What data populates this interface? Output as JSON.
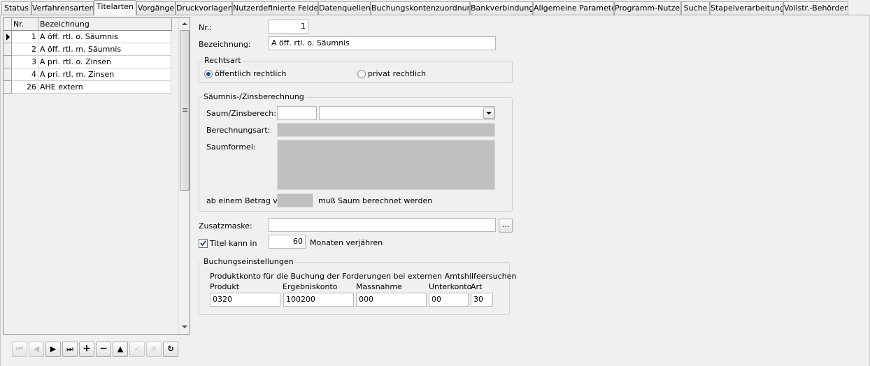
{
  "tabs": [
    {
      "label": "Status"
    },
    {
      "label": "Verfahrensarten"
    },
    {
      "label": "Titelarten"
    },
    {
      "label": "Vorgänge"
    },
    {
      "label": "Druckvorlagen"
    },
    {
      "label": "Nutzerdefinierte Felder"
    },
    {
      "label": "Datenquellen"
    },
    {
      "label": "Buchungskontenzuordnung"
    },
    {
      "label": "Bankverbindung"
    },
    {
      "label": "Allgemeine Parameter"
    },
    {
      "label": "Programm-Nutzer"
    },
    {
      "label": "Suche"
    },
    {
      "label": "Stapelverarbeitung"
    },
    {
      "label": "Vollstr.-Behörden"
    }
  ],
  "active_tab": "Titelarten",
  "grid": {
    "columns": {
      "nr": "Nr.",
      "bez": "Bezeichnung"
    },
    "rows": [
      {
        "nr": "1",
        "bez": "A öff. rtl. o. Säumnis"
      },
      {
        "nr": "2",
        "bez": "A öff. rtl. m. Säumnis"
      },
      {
        "nr": "3",
        "bez": "A pri. rtl. o. Zinsen"
      },
      {
        "nr": "4",
        "bez": "A pri. rtl. m. Zinsen"
      },
      {
        "nr": "26",
        "bez": "AHE extern"
      }
    ]
  },
  "nav_icons": {
    "first": "⏮",
    "prior": "◀",
    "next": "▶",
    "last": "⏭",
    "insert": "+",
    "delete": "−",
    "edit": "▲",
    "post": "✓",
    "cancel": "✕",
    "refresh": "↻"
  },
  "form": {
    "nr_label": "Nr.:",
    "nr_value": "1",
    "bez_label": "Bezeichnung:",
    "bez_value": "A öff. rtl. o. Säumnis",
    "rechtsart": {
      "legend": "Rechtsart",
      "option_public": "öffentlich rechtlich",
      "option_private": "privat rechtlich"
    },
    "saeumnis": {
      "legend": "Säumnis-/Zinsberechnung",
      "saum_label": "Saum/Zinsberech:",
      "saum_code": "",
      "saum_select": "",
      "berechnungsart_label": "Berechnungsart:",
      "saumformel_label": "Saumformel:",
      "betrag_label_before": "ab einem Betrag von",
      "betrag_value": "",
      "betrag_label_after": "muß Saum berechnet werden"
    },
    "zusatzmaske_label": "Zusatzmaske:",
    "zusatzmaske_value": "",
    "ellipsis": "...",
    "titel_kann_in_label": "Titel kann in",
    "monate_value": "60",
    "monate_label": "Monaten verjähren",
    "buchung": {
      "legend": "Buchungseinstellungen",
      "description": "Produktkonto für die Buchung der Forderungen bei externen Amtshilfeersuchen",
      "col_produkt": "Produkt",
      "col_ergebnis": "Ergebniskonto",
      "col_massnahme": "Massnahme",
      "col_unterkonto": "Unterkonto",
      "col_art": "Art",
      "produkt": "0320",
      "ergebniskonto": "100200",
      "massnahme": "000",
      "unterkonto": "00",
      "art": "30"
    }
  }
}
